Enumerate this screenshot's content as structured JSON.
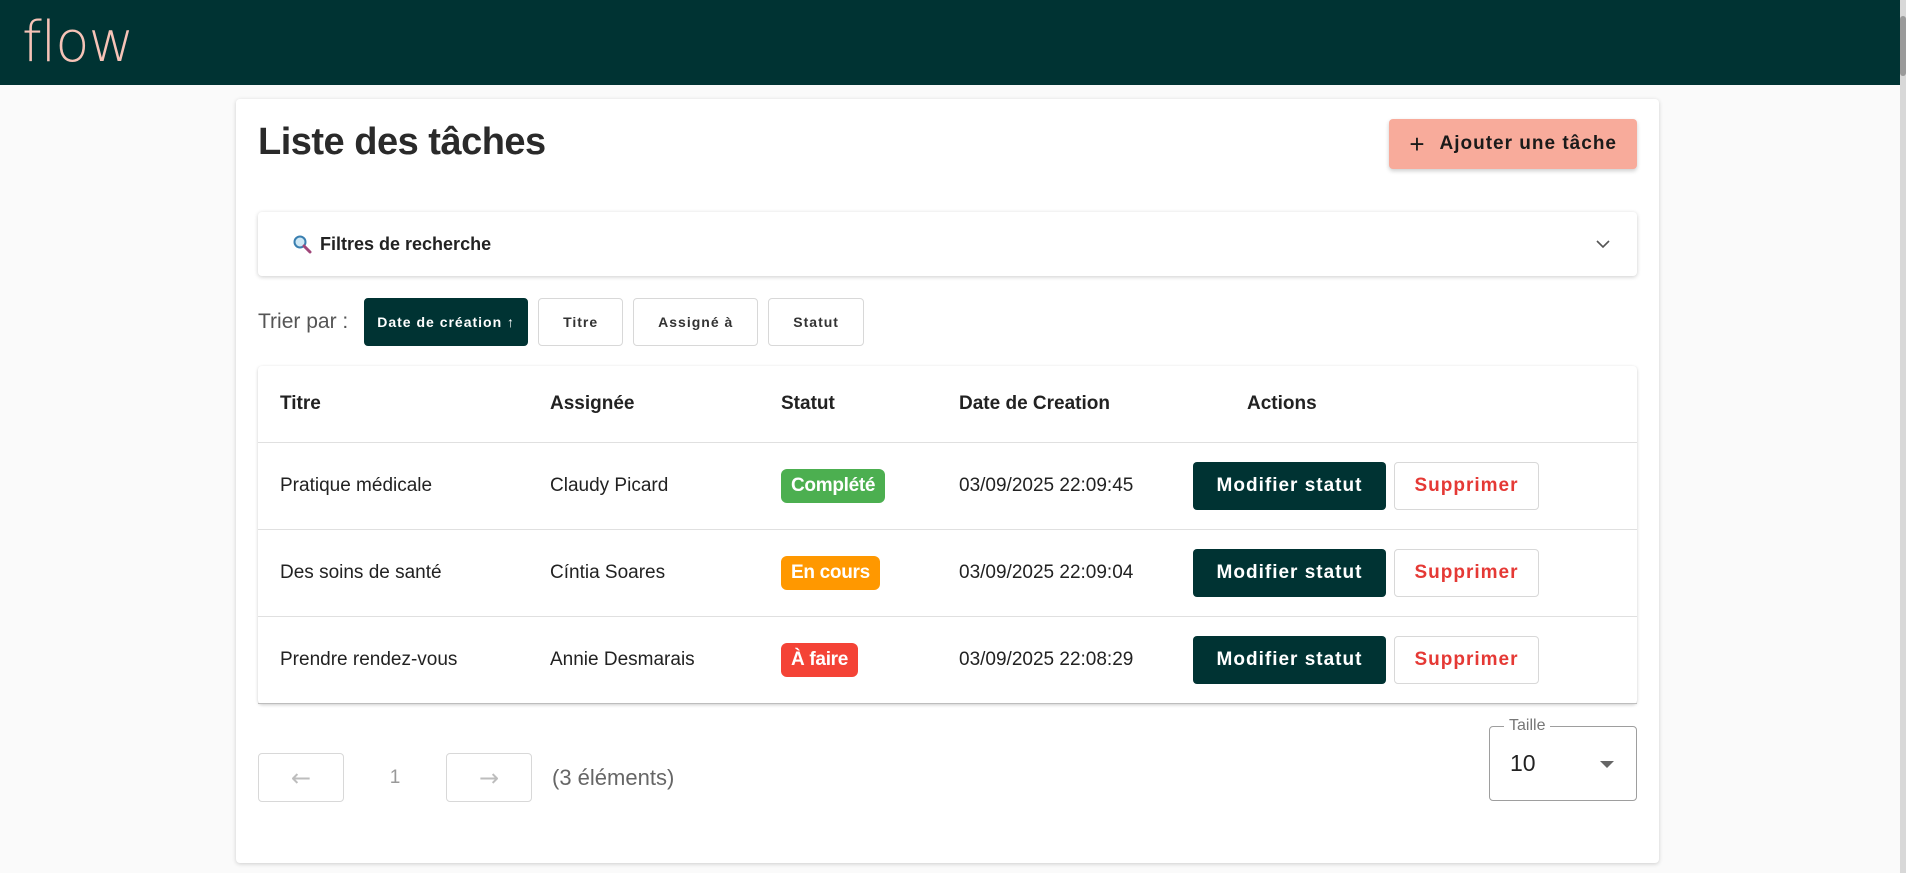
{
  "header": {
    "logo": "flow",
    "background_color": "#003333",
    "logo_color": "#f6c3b7"
  },
  "page": {
    "title": "Liste des tâches",
    "add_button_label": "Ajouter une tâche",
    "add_button_icon": "plus-icon",
    "add_button_color": "#f8ab9b"
  },
  "filters": {
    "label": "Filtres de recherche",
    "icon": "search-icon",
    "expanded": false
  },
  "sort": {
    "label": "Trier par :",
    "options": [
      {
        "label": "Date de création ↑",
        "active": true
      },
      {
        "label": "Titre",
        "active": false
      },
      {
        "label": "Assigné à",
        "active": false
      },
      {
        "label": "Statut",
        "active": false
      }
    ]
  },
  "table": {
    "columns": [
      "Titre",
      "Assignée",
      "Statut",
      "Date de Creation",
      "Actions"
    ],
    "rows": [
      {
        "title": "Pratique médicale",
        "assignee": "Claudy Picard",
        "status": "Complété",
        "status_color": "#4caf50",
        "created": "03/09/2025 22:09:45",
        "modify_label": "Modifier statut",
        "delete_label": "Supprimer"
      },
      {
        "title": "Des soins de santé",
        "assignee": "Cíntia Soares",
        "status": "En cours",
        "status_color": "#ff9800",
        "created": "03/09/2025 22:09:04",
        "modify_label": "Modifier statut",
        "delete_label": "Supprimer"
      },
      {
        "title": "Prendre rendez-vous",
        "assignee": "Annie Desmarais",
        "status": "À faire",
        "status_color": "#f44336",
        "created": "03/09/2025 22:08:29",
        "modify_label": "Modifier statut",
        "delete_label": "Supprimer"
      }
    ]
  },
  "pagination": {
    "prev": "←",
    "page": "1",
    "next": "→",
    "count": "(3 éléments)"
  },
  "page_size": {
    "label": "Taille",
    "value": "10"
  }
}
